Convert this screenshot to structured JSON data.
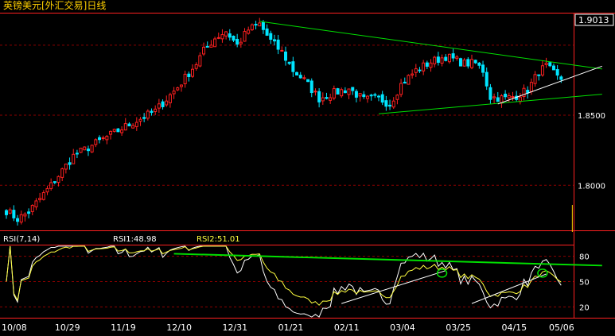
{
  "colors": {
    "background": "#000000",
    "up": "#ff2020",
    "down": "#00e5ff",
    "grid": "#8b0000",
    "trend": "#00e000",
    "support": "#ffffff",
    "title": "#ffd000",
    "rsi1": "#ffffff",
    "rsi2": "#ffff40",
    "axis_text": "#ffffff",
    "price_box": "#ffffff"
  },
  "chart_data": [
    {
      "type": "candlestick",
      "title": "英镑美元[外汇交易]日线",
      "current_price_label": "1.9013",
      "y_ticks": [
        {
          "value": 1.85,
          "label": "1.8500"
        },
        {
          "value": 1.8,
          "label": "1.8000"
        }
      ],
      "ylim": [
        1.769,
        1.922
      ],
      "x_tick_labels": [
        "10/08",
        "10/29",
        "11/19",
        "12/10",
        "12/31",
        "01/21",
        "02/11",
        "03/04",
        "03/25",
        "04/15",
        "05/06"
      ],
      "first_tick_bar": 1,
      "tick_step_bars": 15,
      "bar_count": 150,
      "ohlc_key_points": [
        [
          0,
          1.782
        ],
        [
          3,
          1.776
        ],
        [
          6,
          1.781
        ],
        [
          12,
          1.8
        ],
        [
          18,
          1.821
        ],
        [
          24,
          1.83
        ],
        [
          32,
          1.842
        ],
        [
          40,
          1.853
        ],
        [
          46,
          1.87
        ],
        [
          51,
          1.887
        ],
        [
          53,
          1.896
        ],
        [
          56,
          1.905
        ],
        [
          59,
          1.91
        ],
        [
          62,
          1.9
        ],
        [
          65,
          1.911
        ],
        [
          68,
          1.915
        ],
        [
          71,
          1.903
        ],
        [
          74,
          1.895
        ],
        [
          77,
          1.882
        ],
        [
          80,
          1.875
        ],
        [
          84,
          1.862
        ],
        [
          88,
          1.866
        ],
        [
          92,
          1.869
        ],
        [
          96,
          1.861
        ],
        [
          100,
          1.862
        ],
        [
          103,
          1.858
        ],
        [
          106,
          1.872
        ],
        [
          110,
          1.882
        ],
        [
          114,
          1.888
        ],
        [
          118,
          1.892
        ],
        [
          123,
          1.887
        ],
        [
          126,
          1.887
        ],
        [
          128,
          1.882
        ],
        [
          130,
          1.863
        ],
        [
          134,
          1.862
        ],
        [
          137,
          1.864
        ],
        [
          140,
          1.868
        ],
        [
          143,
          1.881
        ],
        [
          145,
          1.885
        ],
        [
          148,
          1.877
        ],
        [
          151,
          1.874
        ],
        [
          154,
          1.88
        ]
      ],
      "trend_lines": [
        {
          "name": "upper-resistance",
          "points": [
            [
              68,
              1.917
            ],
            [
              160,
              1.883
            ]
          ]
        },
        {
          "name": "lower-support",
          "points": [
            [
              100,
              1.851
            ],
            [
              160,
              1.865
            ]
          ]
        },
        {
          "name": "rising-support",
          "points": [
            [
              132,
              1.858
            ],
            [
              160,
              1.885
            ]
          ]
        }
      ],
      "volume_spike_bar": 152
    },
    {
      "type": "line",
      "title": "RSI(7,14)",
      "series": [
        {
          "name": "RSI1",
          "last_value_label": "48.98",
          "color_key": "rsi1"
        },
        {
          "name": "RSI2",
          "last_value_label": "51.01",
          "color_key": "rsi2"
        }
      ],
      "labels": {
        "name": "RSI(7,14)",
        "rsi1": "RSI1:48.98",
        "rsi2": "RSI2:51.01"
      },
      "y_ticks": [
        80,
        50,
        20
      ],
      "ylim": [
        10,
        90
      ],
      "trend_lines": [
        {
          "name": "rsi-resistance",
          "points": [
            [
              45,
              83
            ],
            [
              160,
              69
            ]
          ]
        },
        {
          "name": "rsi-support-1",
          "points": [
            [
              90,
              24
            ],
            [
              118,
              63
            ]
          ]
        },
        {
          "name": "rsi-support-2",
          "points": [
            [
              125,
              24
            ],
            [
              145,
              59
            ]
          ]
        }
      ],
      "circled_bars": [
        117,
        144
      ]
    }
  ]
}
